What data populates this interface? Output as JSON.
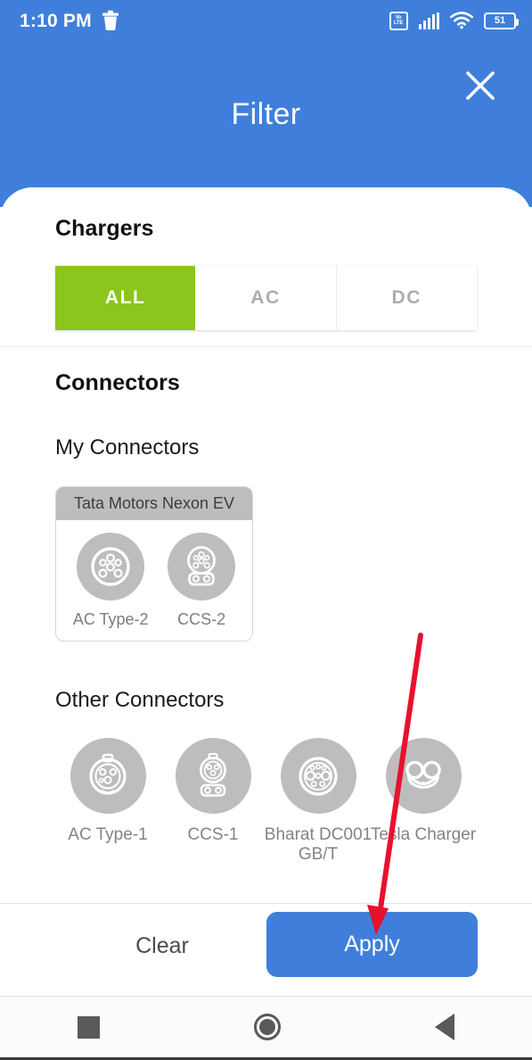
{
  "status_bar": {
    "time": "1:10 PM",
    "trash_icon": "trash-icon",
    "network_label_top": "Vo",
    "network_label_bottom": "LTE",
    "signal_icon": "signal-bars-icon",
    "wifi_icon": "wifi-icon",
    "battery_level": "51"
  },
  "header": {
    "title": "Filter",
    "close_icon": "close-icon"
  },
  "chargers": {
    "section_title": "Chargers",
    "segments": [
      {
        "label": "ALL",
        "active": true
      },
      {
        "label": "AC",
        "active": false
      },
      {
        "label": "DC",
        "active": false
      }
    ]
  },
  "connectors": {
    "section_title": "Connectors",
    "my_connectors_title": "My Connectors",
    "vehicle": {
      "name": "Tata Motors Nexon EV",
      "connectors": [
        {
          "label": "AC Type-2",
          "icon": "ac-type-2-icon"
        },
        {
          "label": "CCS-2",
          "icon": "ccs-2-icon"
        }
      ]
    },
    "other_connectors_title": "Other Connectors",
    "other": [
      {
        "label": "AC Type-1",
        "icon": "ac-type-1-icon"
      },
      {
        "label": "CCS-1",
        "icon": "ccs-1-icon"
      },
      {
        "label": "Bharat DC001 GB/T",
        "icon": "bharat-dc001-gbt-icon"
      },
      {
        "label": "Tesla Charger",
        "icon": "tesla-charger-icon"
      }
    ]
  },
  "footer": {
    "clear_label": "Clear",
    "apply_label": "Apply"
  },
  "navbar": {
    "recents_icon": "square-recents-icon",
    "home_icon": "circle-home-icon",
    "back_icon": "triangle-back-icon"
  },
  "colors": {
    "header_blue": "#3f7fdb",
    "segment_green": "#8cc51c",
    "apply_blue": "#3f7fdb",
    "connector_disc_gray": "#bdbdbd",
    "annotation_red": "#e8112d"
  }
}
